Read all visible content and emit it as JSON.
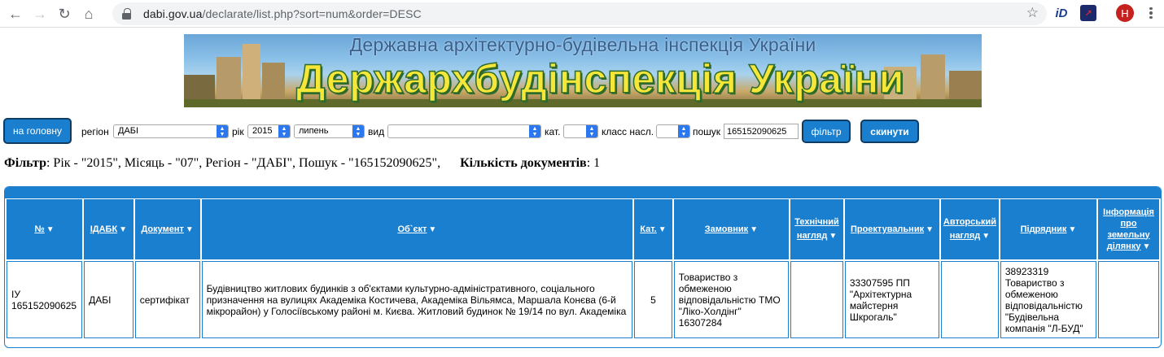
{
  "browser": {
    "url_host": "dabi.gov.ua",
    "url_path": "/declarate/list.php?sort=num&order=DESC",
    "avatar_letter": "H",
    "ext1_label": "iD",
    "ext2_label": "↗"
  },
  "banner": {
    "subtitle": "Державна архітектурно-будівельна інспекція України",
    "title": "Держархбудінспекція України"
  },
  "filter": {
    "home_label": "на головну",
    "region_label": "регіон",
    "region_value": "ДАБІ",
    "year_label": "рік",
    "year_value": "2015",
    "month_value": "липень",
    "type_label": "вид",
    "type_value": "",
    "cat_label": "кат.",
    "cat_value": "",
    "class_label": "класс насл.",
    "class_value": "",
    "search_label": "пошук",
    "search_value": "165152090625",
    "filter_btn": "фільтр",
    "reset_btn": "скинути"
  },
  "summary": {
    "filter_label": "Фільтр",
    "filter_text": ": Рік - \"2015\", Місяць - \"07\", Регіон - \"ДАБІ\", Пошук - \"165152090625\",",
    "count_label": "Кількість документів",
    "count_text": ": 1"
  },
  "table": {
    "headers": [
      "№",
      "ІДАБК",
      "Документ",
      "Об`єкт",
      "Кат.",
      "Замовник",
      "Технічний нагляд",
      "Проектувальник",
      "Авторський нагляд",
      "Підрядник",
      "Інформація про земельну ділянку"
    ],
    "row": {
      "num": "ІУ 165152090625",
      "idabk": "ДАБІ",
      "doc": "сертифікат",
      "object": "Будівництво житлових будинків з об'єктами культурно-адміністративного, соціального призначення на вулицях Академіка Костичева, Академіка Вільямса, Маршала Конєва (6-й мікрорайон) у Голосіївському районі м. Києва. Житловий будинок № 19/14 по вул. Академіка",
      "cat": "5",
      "customer": "Товариство з обмеженою відповідальністю ТМО \"Ліко-Холдінг\" 16307284",
      "tech": "",
      "designer": "33307595 ПП \"Архітектурна майстерня Шкрогаль\"",
      "author": "",
      "contractor": "38923319 Товариство з обмеженою відповідальністю \"Будівельна компанія \"Л-БУД\"",
      "land": ""
    }
  }
}
